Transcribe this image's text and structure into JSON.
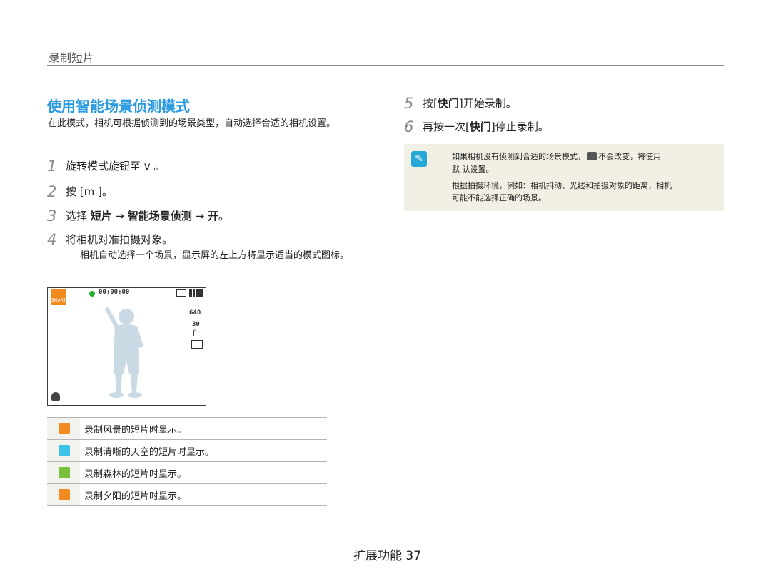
{
  "section_title": "录制短片",
  "heading": "使用智能场景侦测模式",
  "intro": "在此模式，相机可根据侦测到的场景类型，自动选择合适的相机设置。",
  "steps": [
    {
      "num": "1",
      "text": "旋转模式旋钮至 v 。"
    },
    {
      "num": "2",
      "text": "按 [m ]。"
    },
    {
      "num": "3",
      "text_pre": "选择 ",
      "b1": "短片",
      "arrow1": " → ",
      "b2": "智能场景侦测",
      "arrow2": " → ",
      "b3": "开",
      "text_post": "。"
    },
    {
      "num": "4",
      "text": "将相机对准拍摄对象。",
      "desc": "相机自动选择一个场景，显示屏的左上方将显示适当的模式图标。"
    },
    {
      "num": "5",
      "text_pre": "按[",
      "b": "快门",
      "text_post": "]开始录制。"
    },
    {
      "num": "6",
      "text_pre": "再按一次[",
      "b": "快门",
      "text_post": "]停止录制。"
    }
  ],
  "screen": {
    "smart_label": "SMART",
    "rec_time": "00:00:00",
    "resolution": "640",
    "fps": "30"
  },
  "scene_icons": [
    {
      "icon": "landscape-icon",
      "color": "#f18a1f",
      "text": "录制风景的短片时显示。"
    },
    {
      "icon": "blue-sky-icon",
      "color": "#3dc3ea",
      "text": "录制清晰的天空的短片时显示。"
    },
    {
      "icon": "forest-icon",
      "color": "#77c23a",
      "text": "录制森林的短片时显示。"
    },
    {
      "icon": "sunset-icon",
      "color": "#f18a1f",
      "text": "录制夕阳的短片时显示。"
    }
  ],
  "note": {
    "line1_a": "如果相机没有侦测到合适的场景模式，",
    "line1_b": "不会改变，将使用",
    "line2": "默 认设置。",
    "line3": "根据拍摄环境，例如：相机抖动、光线和拍摄对象的距离，相机",
    "line4": "可能不能选择正确的场景。"
  },
  "footer": "扩展功能 37"
}
